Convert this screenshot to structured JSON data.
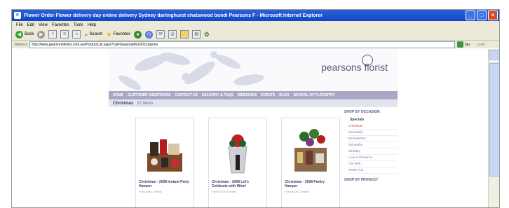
{
  "window": {
    "title": "Flower Order Flower delivery day online delivery Sydney darlinghurst chatswood bondi Pearsons F - Microsoft Internet Explorer",
    "app_icon": "ie-icon",
    "controls": [
      "_",
      "□",
      "×"
    ]
  },
  "menu": [
    "File",
    "Edit",
    "View",
    "Favorites",
    "Tools",
    "Help"
  ],
  "toolbar": {
    "back_label": "Back",
    "search_label": "Search",
    "favorites_label": "Favorites"
  },
  "address": {
    "label": "Address",
    "url": "http://www.pearsonsflorist.com.au/ProductList.aspx?cat=Seasonal%20Occasions",
    "go_label": "Go",
    "links_label": "Links"
  },
  "site": {
    "logo": "pearsons florist",
    "nav": [
      "HOME",
      "CUSTOMER ASSISTANCE",
      "CONTACT US",
      "DELIVERY & FAQS",
      "WEDDINGS",
      "EVENTS",
      "BLOG",
      "SCHOOL OF FLORISTRY"
    ],
    "category": "Christmas",
    "item_count": "12 Items",
    "products": [
      {
        "name": "Christmas - 2008 Instant Party Hamper",
        "meta": "From $98 | Details"
      },
      {
        "name": "Christmas - 2008 Let's Celebrate with Wine!",
        "meta": "From $110 | Details"
      },
      {
        "name": "Christmas - 2008 Pantry Hamper",
        "meta": "From $136 | Details"
      }
    ],
    "sidebar": {
      "heading": "SHOP BY OCCASION",
      "subheading": "Specials",
      "items": [
        "Christmas",
        "New Baby",
        "Best Wishes",
        "Sympathy",
        "Birthday",
        "Love & Romance",
        "Get Well",
        "Thank You"
      ],
      "selected": "Christmas",
      "next_heading": "SHOP BY PRODUCT"
    }
  }
}
